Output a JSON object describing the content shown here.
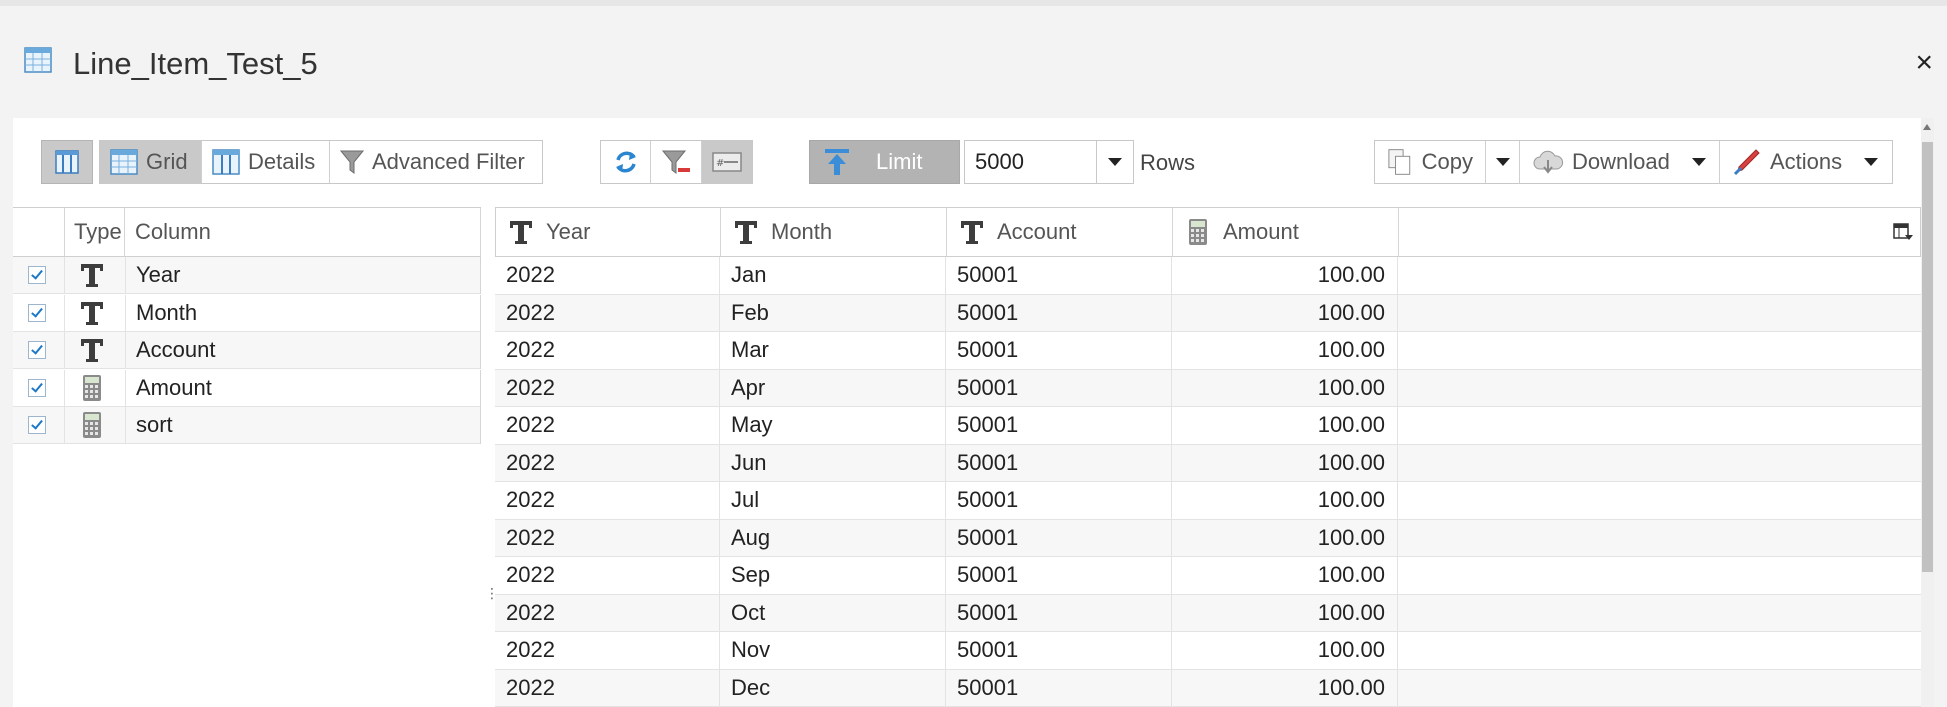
{
  "window": {
    "title": "Line_Item_Test_5",
    "title_icon": "table-icon",
    "close_label": "×"
  },
  "toolbar": {
    "view_modes": [
      {
        "label": "Grid",
        "icon": "grid-view-icon",
        "active": true
      },
      {
        "label": "Details",
        "icon": "details-view-icon",
        "active": false
      },
      {
        "label": "Advanced Filter",
        "icon": "funnel-icon",
        "active": false
      }
    ],
    "limit_label": "Limit",
    "limit_value": "5000",
    "rows_label": "Rows",
    "copy_label": "Copy",
    "download_label": "Download",
    "actions_label": "Actions"
  },
  "columns_panel": {
    "headers": {
      "type": "Type",
      "column": "Column"
    },
    "items": [
      {
        "name": "Year",
        "type": "text",
        "checked": true
      },
      {
        "name": "Month",
        "type": "text",
        "checked": true
      },
      {
        "name": "Account",
        "type": "text",
        "checked": true
      },
      {
        "name": "Amount",
        "type": "numeric",
        "checked": true
      },
      {
        "name": "sort",
        "type": "numeric",
        "checked": true
      }
    ]
  },
  "grid": {
    "columns": [
      {
        "label": "Year",
        "type": "text"
      },
      {
        "label": "Month",
        "type": "text"
      },
      {
        "label": "Account",
        "type": "text"
      },
      {
        "label": "Amount",
        "type": "numeric"
      }
    ],
    "rows": [
      [
        "2022",
        "Jan",
        "50001",
        "100.00"
      ],
      [
        "2022",
        "Feb",
        "50001",
        "100.00"
      ],
      [
        "2022",
        "Mar",
        "50001",
        "100.00"
      ],
      [
        "2022",
        "Apr",
        "50001",
        "100.00"
      ],
      [
        "2022",
        "May",
        "50001",
        "100.00"
      ],
      [
        "2022",
        "Jun",
        "50001",
        "100.00"
      ],
      [
        "2022",
        "Jul",
        "50001",
        "100.00"
      ],
      [
        "2022",
        "Aug",
        "50001",
        "100.00"
      ],
      [
        "2022",
        "Sep",
        "50001",
        "100.00"
      ],
      [
        "2022",
        "Oct",
        "50001",
        "100.00"
      ],
      [
        "2022",
        "Nov",
        "50001",
        "100.00"
      ],
      [
        "2022",
        "Dec",
        "50001",
        "100.00"
      ]
    ]
  },
  "colors": {
    "accent_blue": "#1e78c8",
    "active_toggle": "#c9c9c9",
    "limit_button": "#b3b3b3"
  }
}
